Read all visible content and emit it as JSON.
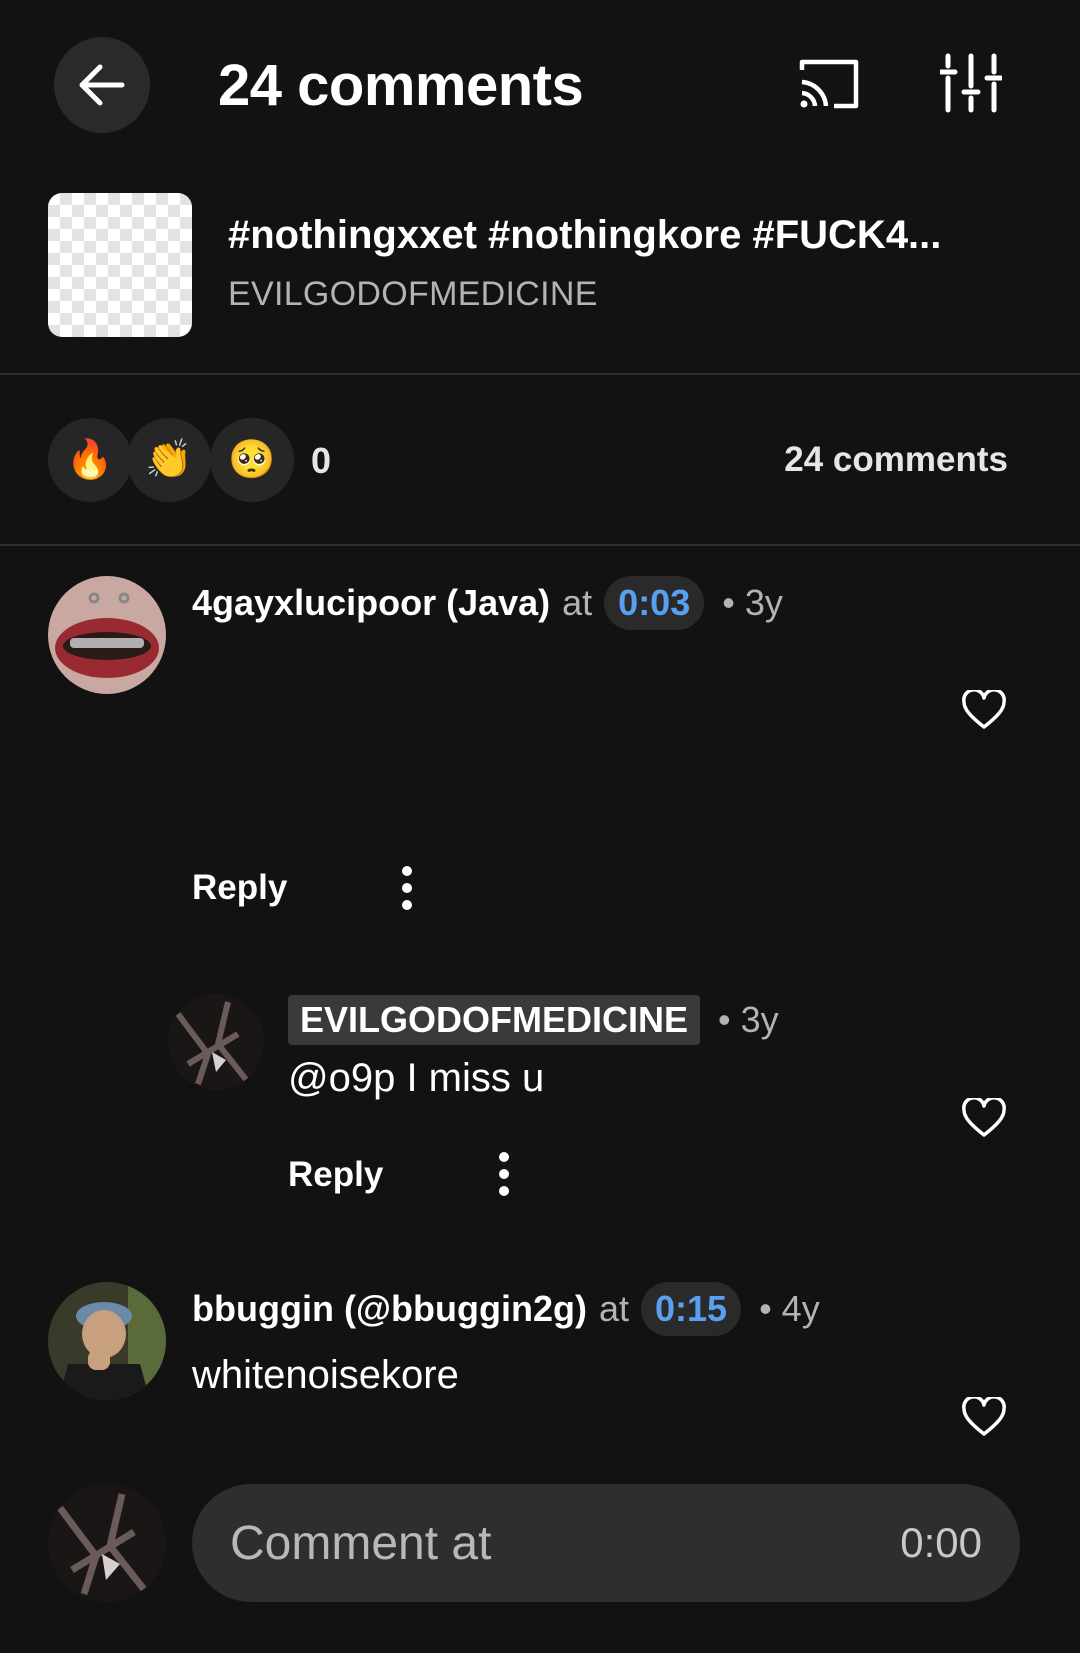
{
  "header": {
    "title": "24 comments",
    "back_icon": "arrow-left-icon",
    "cast_icon": "cast-icon",
    "filter_icon": "sliders-icon"
  },
  "track": {
    "title": "#nothingxxet #nothingkore #FUCK4...",
    "artist": "EVILGODOFMEDICINE"
  },
  "reactions": {
    "emojis": [
      "🔥",
      "👏",
      "🥺"
    ],
    "count": "0",
    "comments_count": "24 comments"
  },
  "comments": [
    {
      "username": "4gayxlucipoor (Java)",
      "at": "at",
      "timestamp": "0:03",
      "age": "• 3y",
      "body": "",
      "reply_label": "Reply",
      "replies": [
        {
          "username": "EVILGODOFMEDICINE",
          "age": "• 3y",
          "body": "@o9p I miss u",
          "reply_label": "Reply"
        }
      ]
    },
    {
      "username": "bbuggin (@bbuggin2g)",
      "at": "at",
      "timestamp": "0:15",
      "age": "• 4y",
      "body": "whitenoisekore"
    }
  ],
  "composer": {
    "placeholder": "Comment at",
    "time": "0:00"
  },
  "colors": {
    "background": "#121212",
    "accent": "#5aa0f0",
    "surface": "#2a2a2a"
  }
}
